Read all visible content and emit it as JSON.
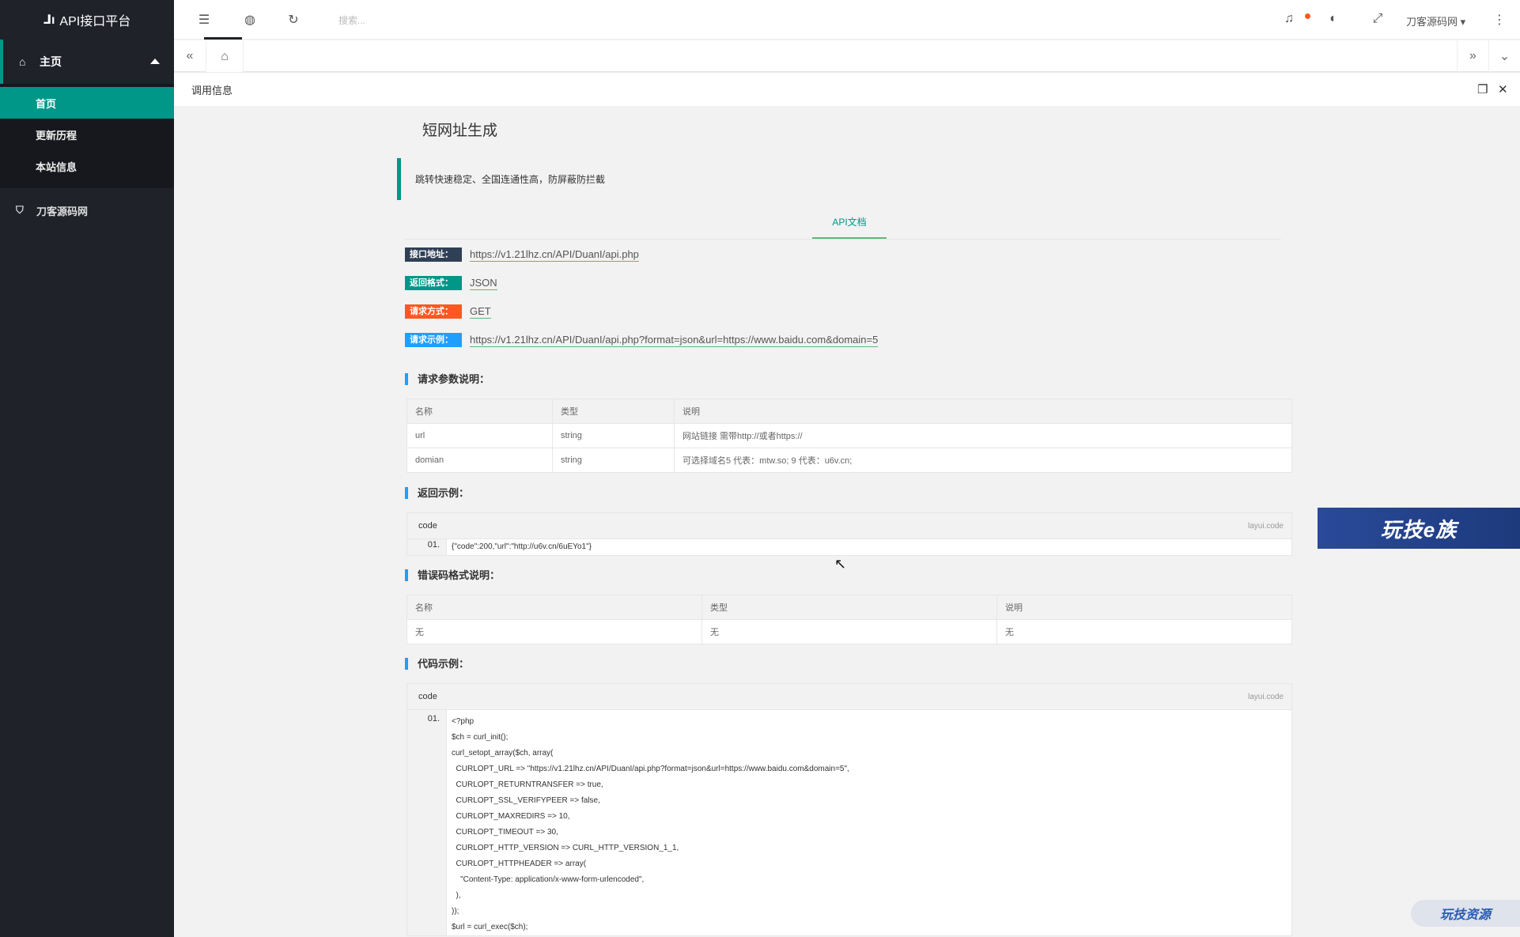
{
  "app": {
    "title": "API接口平台"
  },
  "sidebar": {
    "group": {
      "label": "主页",
      "items": [
        {
          "label": "首页"
        },
        {
          "label": "更新历程"
        },
        {
          "label": "本站信息"
        }
      ]
    },
    "extra": {
      "label": "刀客源码网"
    }
  },
  "header": {
    "search_placeholder": "搜索...",
    "user": "刀客源码网"
  },
  "crumb": {
    "title": "调用信息"
  },
  "page": {
    "title": "短网址生成",
    "desc": "跳转快速稳定、全国连通性高，防屏蔽防拦截",
    "tab": "API文档",
    "info": [
      {
        "label": "接口地址：",
        "value": "https://v1.21lhz.cn/API/DuanI/api.php"
      },
      {
        "label": "返回格式：",
        "value": "JSON"
      },
      {
        "label": "请求方式：",
        "value": "GET"
      },
      {
        "label": "请求示例：",
        "value": "https://v1.21lhz.cn/API/DuanI/api.php?format=json&url=https://www.baidu.com&domain=5"
      }
    ],
    "params": {
      "heading": "请求参数说明：",
      "headers": [
        "名称",
        "类型",
        "说明"
      ],
      "rows": [
        [
          "url",
          "string",
          "网站链接 需带http://或者https://"
        ],
        [
          "domian",
          "string",
          "可选择域名5 代表：mtw.so; 9 代表：u6v.cn;"
        ]
      ]
    },
    "return": {
      "heading": "返回示例：",
      "label": "code",
      "lang": "layui.code",
      "num": "01.",
      "line": "{\"code\":200,\"url\":\"http://u6v.cn/6uEYo1\"}"
    },
    "errors": {
      "heading": "错误码格式说明：",
      "headers": [
        "名称",
        "类型",
        "说明"
      ],
      "rows": [
        [
          "无",
          "无",
          "无"
        ]
      ]
    },
    "sample": {
      "heading": "代码示例：",
      "label": "code",
      "lang": "layui.code",
      "num": "01.",
      "lines": [
        "<?php",
        "$ch = curl_init();",
        "curl_setopt_array($ch, array(",
        "  CURLOPT_URL => \"https://v1.21lhz.cn/API/DuanI/api.php?format=json&url=https://www.baidu.com&domain=5\",",
        "  CURLOPT_RETURNTRANSFER => true,",
        "  CURLOPT_SSL_VERIFYPEER => false,",
        "  CURLOPT_MAXREDIRS => 10,",
        "  CURLOPT_TIMEOUT => 30,",
        "  CURLOPT_HTTP_VERSION => CURL_HTTP_VERSION_1_1,",
        "  CURLOPT_HTTPHEADER => array(",
        "    \"Content-Type: application/x-www-form-urlencoded\",",
        "  ),",
        "));",
        "$url = curl_exec($ch);"
      ]
    }
  },
  "overlays": {
    "banner": "玩技e族",
    "watermark": "玩技资源"
  }
}
